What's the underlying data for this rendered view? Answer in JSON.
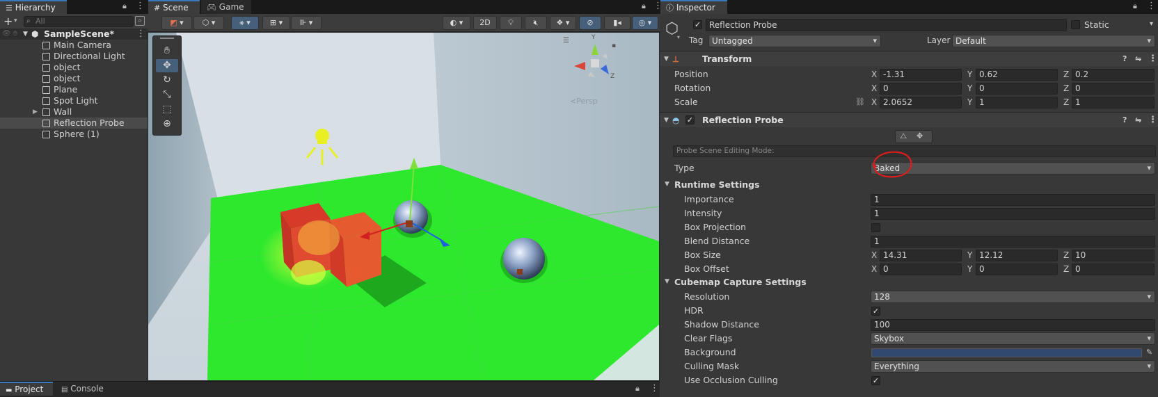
{
  "hierarchy": {
    "tab_label": "Hierarchy",
    "search_placeholder": "All",
    "scene_name": "SampleScene*",
    "items": [
      {
        "label": "Main Camera"
      },
      {
        "label": "Directional Light"
      },
      {
        "label": "object"
      },
      {
        "label": "object"
      },
      {
        "label": "Plane"
      },
      {
        "label": "Spot Light"
      },
      {
        "label": "Wall"
      },
      {
        "label": "Reflection Probe"
      },
      {
        "label": "Sphere (1)"
      }
    ]
  },
  "scene": {
    "tabs": [
      {
        "label": "Scene"
      },
      {
        "label": "Game"
      }
    ],
    "toolbar": {
      "mode_2d": "2D"
    },
    "gizmo": {
      "axis_x": "X",
      "axis_y": "Y",
      "axis_z": "Z",
      "persp_label": "Persp"
    }
  },
  "bottom": {
    "tabs": [
      {
        "label": "Project"
      },
      {
        "label": "Console"
      }
    ]
  },
  "inspector": {
    "tab_label": "Inspector",
    "object_name": "Reflection Probe",
    "static_label": "Static",
    "tag_label": "Tag",
    "tag_value": "Untagged",
    "layer_label": "Layer",
    "layer_value": "Default",
    "transform": {
      "title": "Transform",
      "position_label": "Position",
      "rotation_label": "Rotation",
      "scale_label": "Scale",
      "position": {
        "x": "-1.31",
        "y": "0.62",
        "z": "0.2"
      },
      "rotation": {
        "x": "0",
        "y": "0",
        "z": "0"
      },
      "scale": {
        "x": "2.0652",
        "y": "1",
        "z": "1"
      }
    },
    "probe": {
      "title": "Reflection Probe",
      "editing_mode_label": "Probe Scene Editing Mode:",
      "type_label": "Type",
      "type_value": "Baked",
      "runtime_title": "Runtime Settings",
      "importance_label": "Importance",
      "importance": "1",
      "intensity_label": "Intensity",
      "intensity": "1",
      "box_projection_label": "Box Projection",
      "blend_distance_label": "Blend Distance",
      "blend_distance": "1",
      "box_size_label": "Box Size",
      "box_size": {
        "x": "14.31",
        "y": "12.12",
        "z": "10"
      },
      "box_offset_label": "Box Offset",
      "box_offset": {
        "x": "0",
        "y": "0",
        "z": "0"
      },
      "cubemap_title": "Cubemap Capture Settings",
      "resolution_label": "Resolution",
      "resolution": "128",
      "hdr_label": "HDR",
      "shadow_distance_label": "Shadow Distance",
      "shadow_distance": "100",
      "clear_flags_label": "Clear Flags",
      "clear_flags": "Skybox",
      "background_label": "Background",
      "background_color": "#31496f",
      "culling_mask_label": "Culling Mask",
      "culling_mask": "Everything",
      "occlusion_label": "Use Occlusion Culling"
    },
    "axis_labels": {
      "x": "X",
      "y": "Y",
      "z": "Z"
    }
  },
  "colors": {
    "accent": "#3a79bb",
    "highlight_circle": "#e01b1b",
    "ground": "#2ee82e"
  }
}
